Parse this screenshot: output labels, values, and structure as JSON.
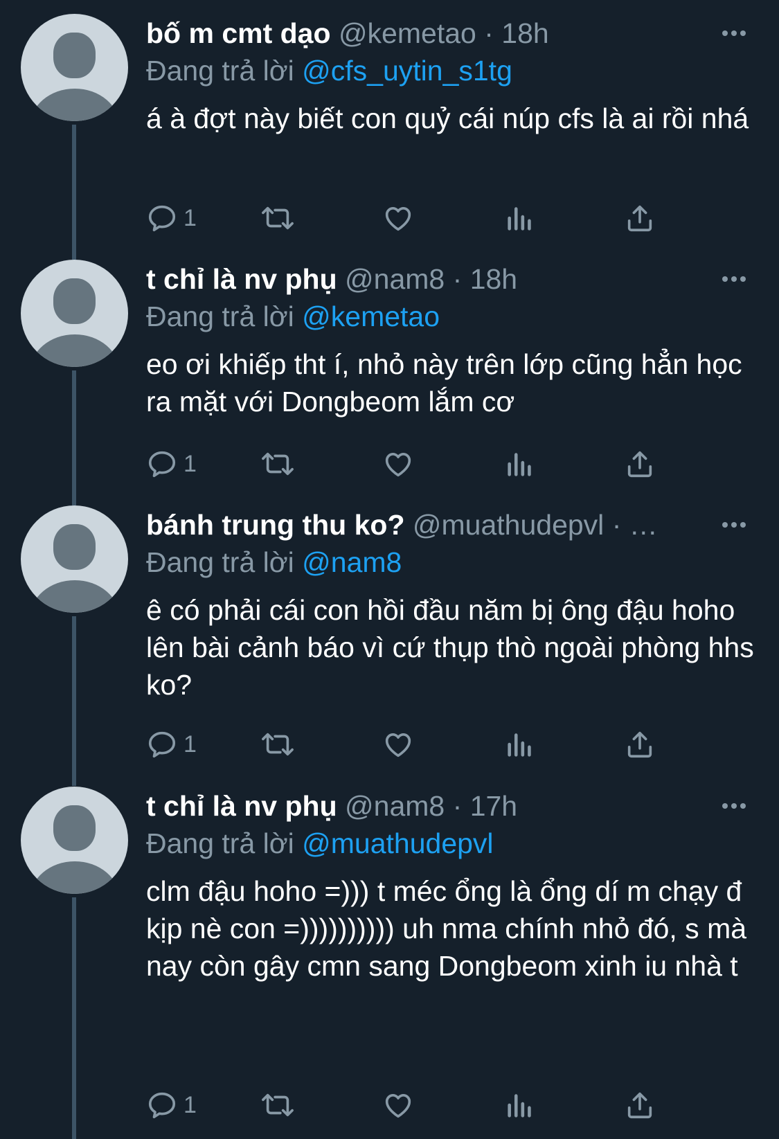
{
  "tweets": [
    {
      "name": "bố m cmt dạo",
      "handle": "@kemetao",
      "dot": "·",
      "time": "18h",
      "reply_prefix": "Đang trả lời",
      "reply_to": "@cfs_uytin_s1tg",
      "text": "á à đợt này biết con quỷ cái núp cfs là ai rồi nhá",
      "reply_count": "1"
    },
    {
      "name": "t chỉ là nv phụ",
      "handle": "@nam8",
      "dot": "·",
      "time": "18h",
      "reply_prefix": "Đang trả lời",
      "reply_to": "@kemetao",
      "text": "eo ơi khiếp tht í, nhỏ này trên lớp cũng hẳn học ra mặt với Dongbeom lắm cơ",
      "reply_count": "1"
    },
    {
      "name": "bánh trung thu ko?",
      "handle": "@muathudepvl",
      "dot": "·",
      "time": "…",
      "reply_prefix": "Đang trả lời",
      "reply_to": "@nam8",
      "text": "ê có phải cái con hồi đầu năm bị ông đậu hoho lên bài cảnh báo vì cứ thụp thò ngoài phòng hhs ko?",
      "reply_count": "1"
    },
    {
      "name": "t chỉ là nv phụ",
      "handle": "@nam8",
      "dot": "·",
      "time": "17h",
      "reply_prefix": "Đang trả lời",
      "reply_to": "@muathudepvl",
      "text": "clm đậu hoho =))) t méc ổng là ổng dí m chạy đ kịp nè con =)))))))))) uh nma chính nhỏ đó, s mà nay còn gây cmn sang Dongbeom xinh iu nhà t",
      "reply_count": "1"
    }
  ],
  "icons": {
    "more": "more-horizontal-icon",
    "reply": "reply-bubble-icon",
    "retweet": "retweet-icon",
    "like": "heart-icon",
    "analytics": "analytics-bars-icon",
    "share": "share-upload-icon"
  },
  "colors": {
    "background": "#15202b",
    "text": "#ffffff",
    "secondary": "#8899a6",
    "mention": "#1da1f2",
    "thread_line": "#3d5466",
    "avatar_bg": "#ccd6dd",
    "avatar_fg": "#66757f"
  }
}
